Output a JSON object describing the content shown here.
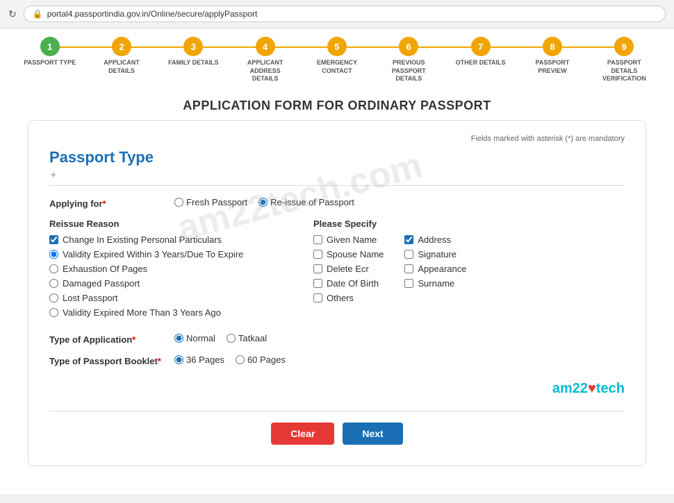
{
  "browser": {
    "url": "portal4.passportindia.gov.in/Online/secure/applyPassport"
  },
  "steps": [
    {
      "number": "1",
      "label": "PASSPORT TYPE",
      "state": "active"
    },
    {
      "number": "2",
      "label": "APPLICANT DETAILS",
      "state": "pending"
    },
    {
      "number": "3",
      "label": "FAMILY DETAILS",
      "state": "pending"
    },
    {
      "number": "4",
      "label": "APPLICANT ADDRESS DETAILS",
      "state": "pending"
    },
    {
      "number": "5",
      "label": "EMERGENCY CONTACT",
      "state": "pending"
    },
    {
      "number": "6",
      "label": "PREVIOUS PASSPORT DETAILS",
      "state": "pending"
    },
    {
      "number": "7",
      "label": "OTHER DETAILS",
      "state": "pending"
    },
    {
      "number": "8",
      "label": "PASSPORT PREVIEW",
      "state": "pending"
    },
    {
      "number": "9",
      "label": "PASSPORT DETAILS VERIFICATION",
      "state": "pending"
    }
  ],
  "page_title": "APPLICATION FORM FOR ORDINARY PASSPORT",
  "mandatory_note": "Fields marked with asterisk (*) are mandatory",
  "section_title": "Passport Type",
  "applying_for": {
    "label": "Applying for",
    "required": true,
    "options": [
      {
        "value": "fresh",
        "label": "Fresh Passport",
        "checked": false
      },
      {
        "value": "reissue",
        "label": "Re-issue of Passport",
        "checked": true
      }
    ]
  },
  "reissue_reason": {
    "label": "Reissue Reason",
    "options": [
      {
        "label": "Change In Existing Personal Particulars",
        "checked": true,
        "type": "checkbox"
      },
      {
        "label": "Validity Expired Within 3 Years/Due To Expire",
        "checked": true,
        "type": "radio"
      },
      {
        "label": "Exhaustion Of Pages",
        "checked": false,
        "type": "radio"
      },
      {
        "label": "Damaged Passport",
        "checked": false,
        "type": "radio"
      },
      {
        "label": "Lost Passport",
        "checked": false,
        "type": "radio"
      },
      {
        "label": "Validity Expired More Than 3 Years Ago",
        "checked": false,
        "type": "radio"
      }
    ]
  },
  "please_specify": {
    "label": "Please Specify",
    "col1": [
      {
        "label": "Given Name",
        "checked": false
      },
      {
        "label": "Spouse Name",
        "checked": false
      },
      {
        "label": "Delete Ecr",
        "checked": false
      },
      {
        "label": "Date Of Birth",
        "checked": false
      },
      {
        "label": "Others",
        "checked": false
      }
    ],
    "col2": [
      {
        "label": "Address",
        "checked": true
      },
      {
        "label": "Signature",
        "checked": false
      },
      {
        "label": "Appearance",
        "checked": false
      },
      {
        "label": "Surname",
        "checked": false
      }
    ]
  },
  "type_of_application": {
    "label": "Type of Application",
    "required": true,
    "options": [
      {
        "value": "normal",
        "label": "Normal",
        "checked": true
      },
      {
        "value": "tatkaal",
        "label": "Tatkaal",
        "checked": false
      }
    ]
  },
  "type_of_booklet": {
    "label": "Type of Passport Booklet",
    "required": true,
    "options": [
      {
        "value": "36",
        "label": "36 Pages",
        "checked": true
      },
      {
        "value": "60",
        "label": "60 Pages",
        "checked": false
      }
    ]
  },
  "buttons": {
    "clear": "Clear",
    "next": "Next"
  },
  "watermark": "am22tech.com"
}
